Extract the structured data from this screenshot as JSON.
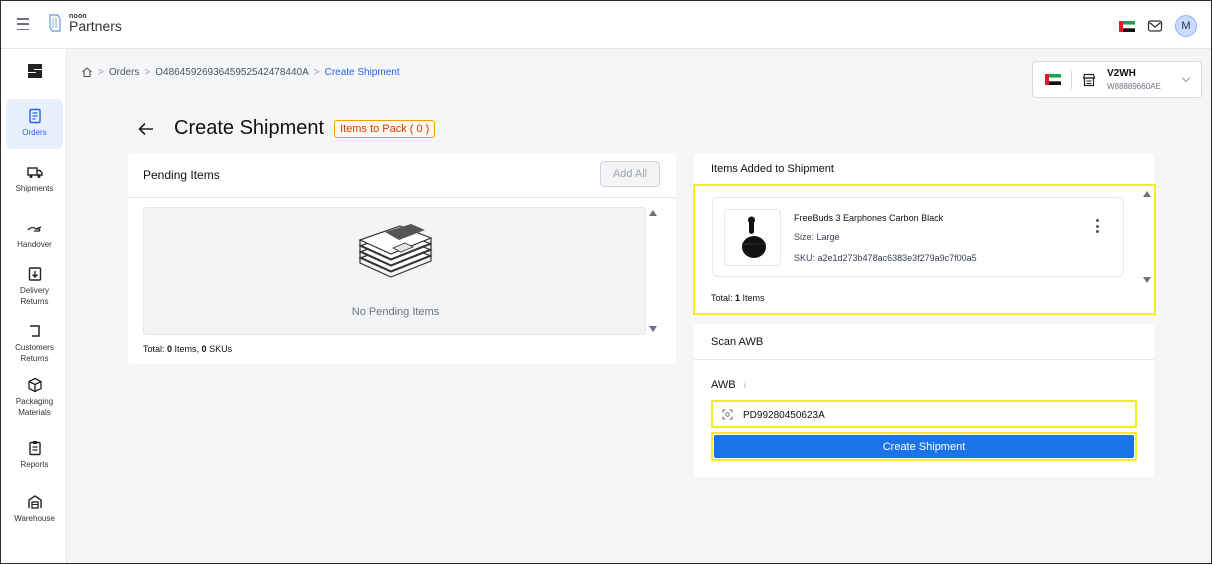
{
  "header": {
    "brand_small": "noon",
    "brand_name": "Partners",
    "avatar_initial": "M",
    "colors": {
      "accent": "#1a73e8",
      "highlight": "#f2ec2a",
      "badge": "#c2410c"
    }
  },
  "sidebar": {
    "items": [
      {
        "label": "Orders",
        "icon": "orders-icon",
        "active": true
      },
      {
        "label": "Shipments",
        "icon": "truck-icon"
      },
      {
        "label": "Handover",
        "icon": "handover-icon"
      },
      {
        "label": "Delivery Returns",
        "icon": "delivery-returns-icon"
      },
      {
        "label": "Customers Returns",
        "icon": "customer-returns-icon"
      },
      {
        "label": "Packaging Materials",
        "icon": "package-icon"
      },
      {
        "label": "Reports",
        "icon": "reports-icon"
      },
      {
        "label": "Warehouse",
        "icon": "warehouse-icon"
      }
    ]
  },
  "breadcrumb": {
    "orders": "Orders",
    "order_id": "O48645926936459525424784​40A",
    "current": "Create Shipment"
  },
  "warehouse": {
    "name": "V2WH",
    "code": "W88889660AE"
  },
  "page": {
    "title": "Create Shipment",
    "badge": "Items to Pack ( 0 )"
  },
  "pending": {
    "heading": "Pending Items",
    "add_all": "Add All",
    "empty_text": "No Pending Items",
    "total_label": "Total: ",
    "total_items": "0",
    "items_word": " Items, ",
    "total_skus": "0",
    "skus_word": " SKUs"
  },
  "added": {
    "heading": "Items Added to Shipment",
    "item": {
      "name": "FreeBuds 3 Earphones Carbon Black",
      "size": "Size: Large",
      "sku": "SKU: a2e1d273b478ac6383e3f279a9c7f00a5"
    },
    "total_label": "Total: ",
    "total_count": "1",
    "items_word": " Items"
  },
  "scan": {
    "heading": "Scan AWB",
    "awb_label": "AWB",
    "info": "i",
    "awb_value": "PD99280450623A",
    "create_button": "Create Shipment"
  }
}
